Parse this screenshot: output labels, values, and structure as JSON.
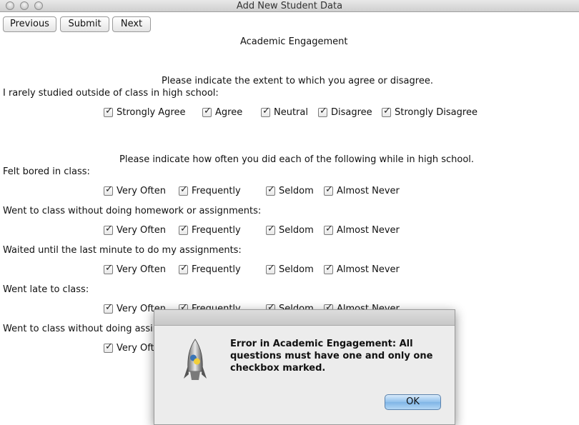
{
  "window": {
    "title": "Add New Student Data"
  },
  "toolbar": {
    "previous": "Previous",
    "submit": "Submit",
    "next": "Next"
  },
  "section_title": "Academic Engagement",
  "block1": {
    "instruction": "Please indicate the extent to which you agree or disagree.",
    "question": "I rarely studied outside of class in high school:",
    "options": [
      "Strongly Agree",
      "Agree",
      "Neutral",
      "Disagree",
      "Strongly Disagree"
    ]
  },
  "block2": {
    "instruction": "Please indicate how often you did each of the following while in high school.",
    "options": [
      "Very Often",
      "Frequently",
      "Seldom",
      "Almost Never"
    ],
    "questions": [
      "Felt bored in class:",
      "Went to class without doing homework or assignments:",
      "Waited until the last minute to do my assignments:",
      "Went late to class:",
      "Went to class without doing assing"
    ],
    "truncated_option": "Very Ofte"
  },
  "dialog": {
    "message": "Error in Academic Engagement: All questions must have one and only one checkbox marked.",
    "ok_label": "OK"
  },
  "colors": {
    "ok_button": "#8fc0ec",
    "dialog_bg": "#ececec"
  },
  "icons": {
    "dialog_icon": "python-rocket-icon",
    "checkbox_state": "checked"
  }
}
